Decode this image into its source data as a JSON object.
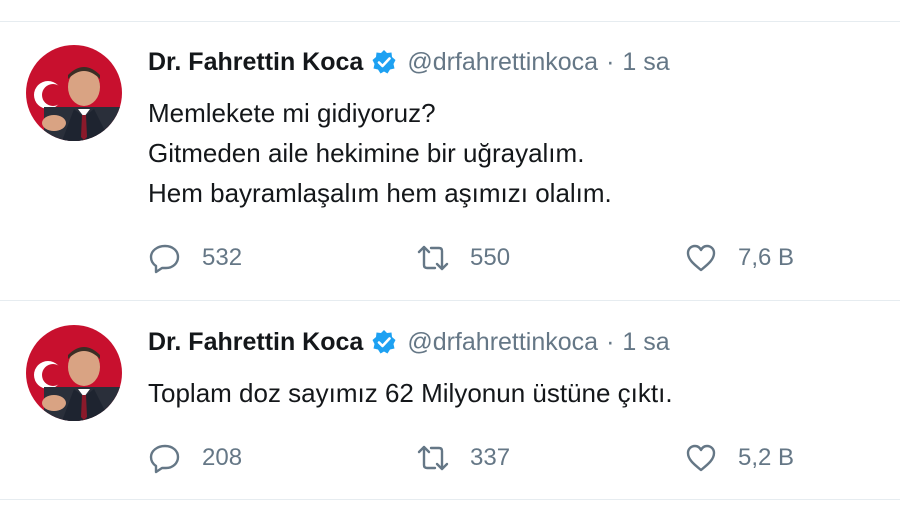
{
  "tweets": [
    {
      "name": "Dr. Fahrettin Koca",
      "handle": "@drfahrettinkoca",
      "separator": "·",
      "time": "1 sa",
      "lines": [
        "Memlekete mi gidiyoruz?",
        "Gitmeden aile hekimine bir uğrayalım.",
        "Hem bayramlaşalım hem aşımızı olalım."
      ],
      "replies": "532",
      "retweets": "550",
      "likes": "7,6 B"
    },
    {
      "name": "Dr. Fahrettin Koca",
      "handle": "@drfahrettinkoca",
      "separator": "·",
      "time": "1 sa",
      "lines": [
        "Toplam doz sayımız 62 Milyonun üstüne çıktı."
      ],
      "replies": "208",
      "retweets": "337",
      "likes": "5,2 B"
    }
  ],
  "colors": {
    "text": "#14171a",
    "secondary": "#657786",
    "verified": "#1da1f2",
    "separator": "#e6ecf0"
  },
  "icons": {
    "reply": "reply-icon",
    "retweet": "retweet-icon",
    "like": "like-icon",
    "verified": "verified-badge-icon"
  }
}
